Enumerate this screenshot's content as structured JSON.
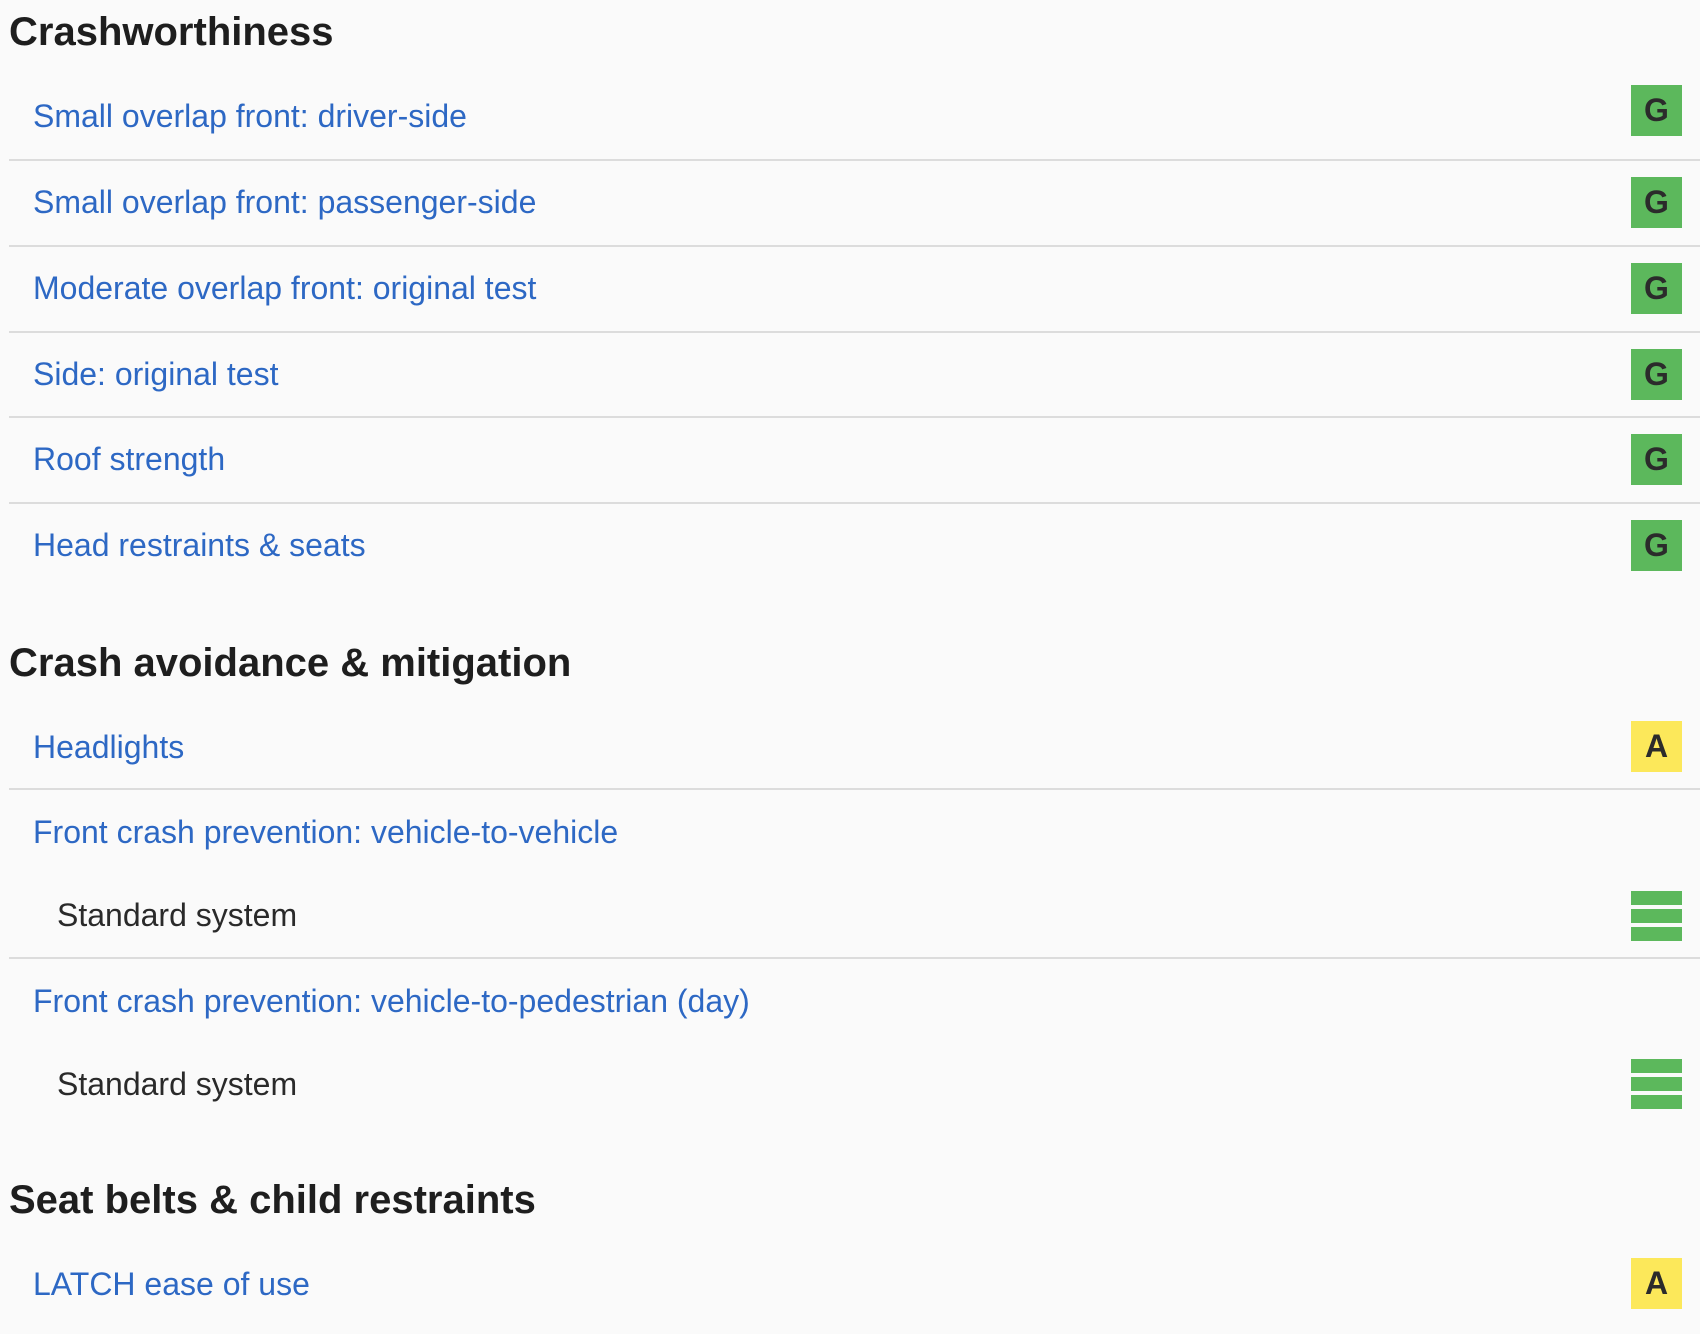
{
  "sections": [
    {
      "title": "Crashworthiness",
      "items": [
        {
          "label": "Small overlap front: driver-side",
          "rating": "G",
          "rating_color": "#5cb85c"
        },
        {
          "label": "Small overlap front: passenger-side",
          "rating": "G",
          "rating_color": "#5cb85c"
        },
        {
          "label": "Moderate overlap front: original test",
          "rating": "G",
          "rating_color": "#5cb85c"
        },
        {
          "label": "Side: original test",
          "rating": "G",
          "rating_color": "#5cb85c"
        },
        {
          "label": "Roof strength",
          "rating": "G",
          "rating_color": "#5cb85c"
        },
        {
          "label": "Head restraints & seats",
          "rating": "G",
          "rating_color": "#5cb85c"
        }
      ]
    },
    {
      "title": "Crash avoidance & mitigation",
      "items": [
        {
          "label": "Headlights",
          "rating": "A",
          "rating_color": "#fce85a"
        },
        {
          "label": "Front crash prevention: vehicle-to-vehicle",
          "sub_label": "Standard system",
          "rating_icon": "three-bar-rating-icon",
          "rating_color": "#5cb85c"
        },
        {
          "label": "Front crash prevention: vehicle-to-pedestrian (day)",
          "sub_label": "Standard system",
          "rating_icon": "three-bar-rating-icon",
          "rating_color": "#5cb85c"
        }
      ]
    },
    {
      "title": "Seat belts & child restraints",
      "items": [
        {
          "label": "LATCH ease of use",
          "rating": "A",
          "rating_color": "#fce85a"
        }
      ]
    }
  ]
}
